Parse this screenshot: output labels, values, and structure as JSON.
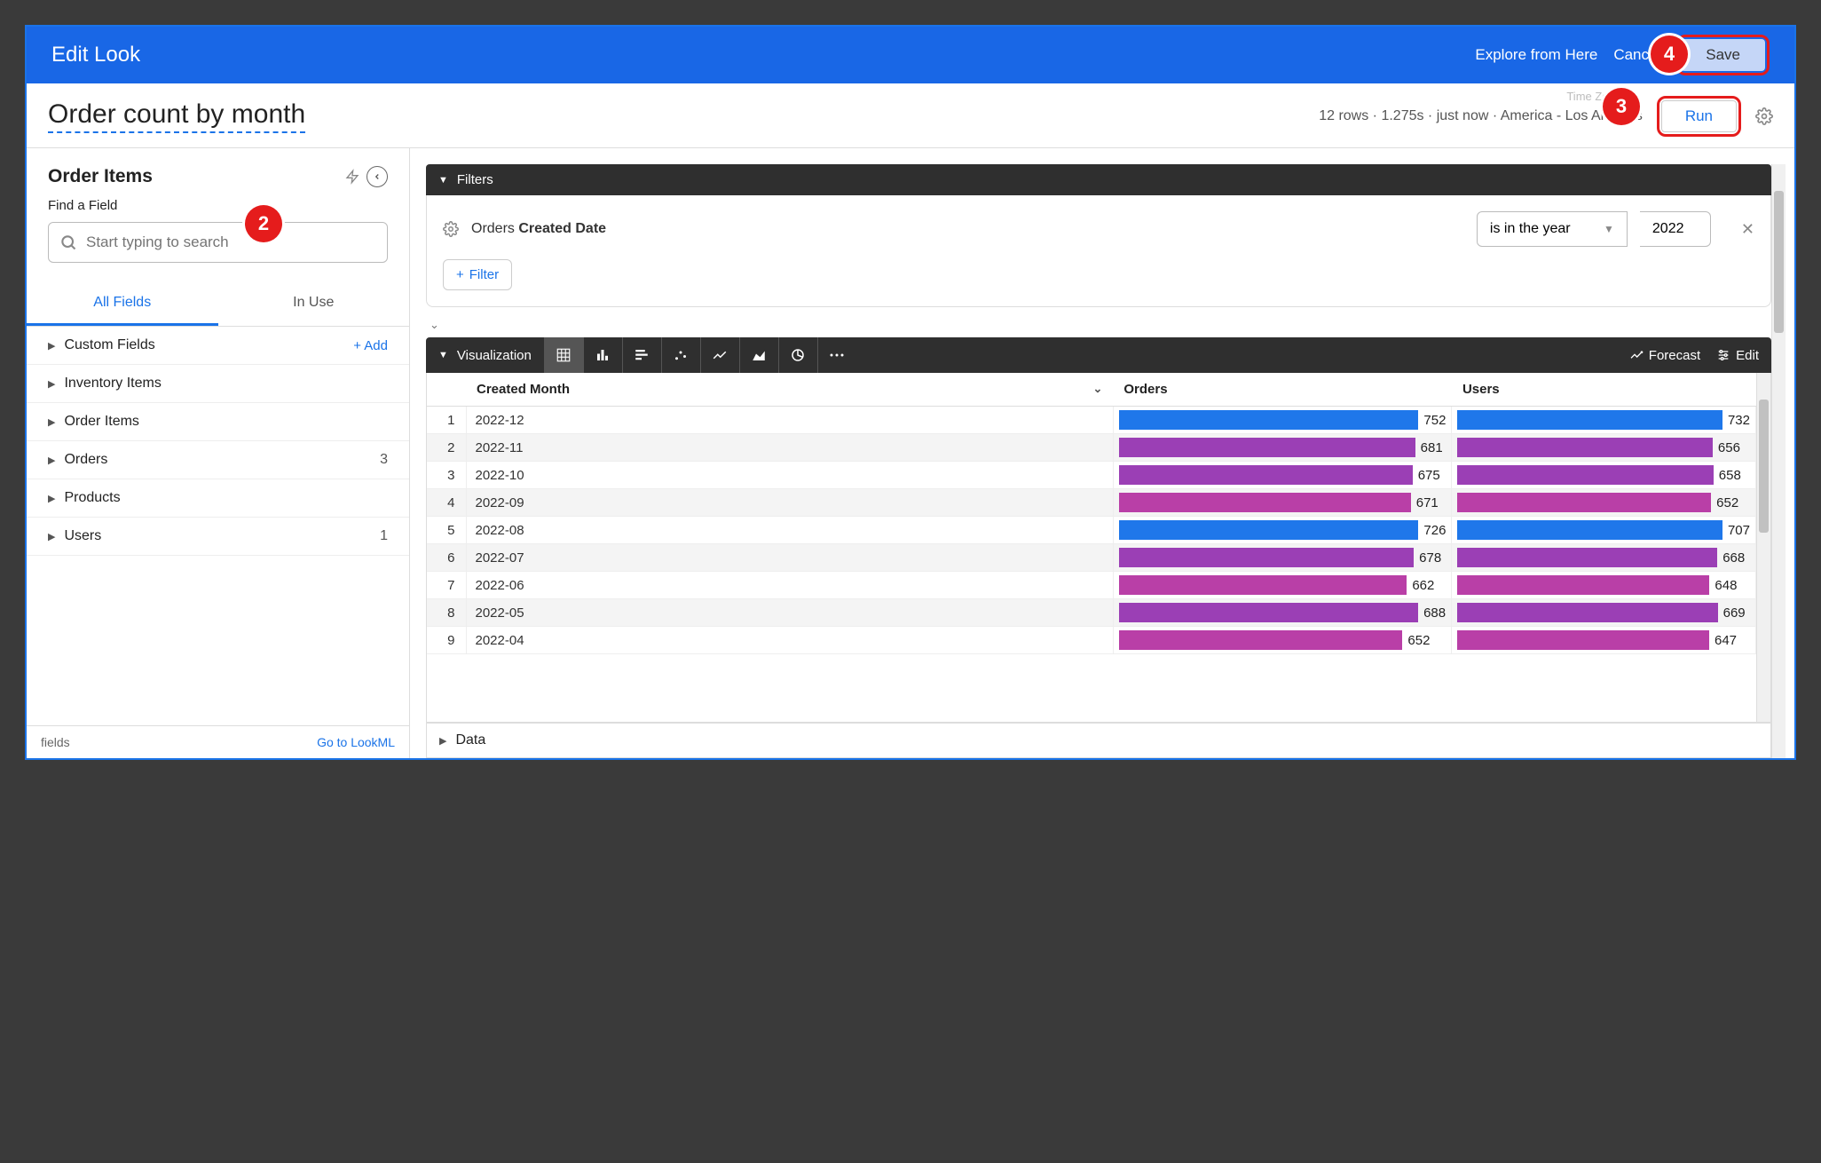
{
  "header": {
    "title": "Edit Look",
    "explore_link": "Explore from Here",
    "cancel_link": "Cancel",
    "save_label": "Save"
  },
  "title_row": {
    "look_title": "Order count by month",
    "timezone_hint": "Time Zone",
    "meta": "12 rows · 1.275s · just now · America - Los Angeles",
    "run_label": "Run"
  },
  "sidebar": {
    "heading": "Order Items",
    "find_label": "Find a Field",
    "search_placeholder": "Start typing to search",
    "tabs": {
      "all": "All Fields",
      "in_use": "In Use"
    },
    "add_label": "+  Add",
    "items": [
      {
        "label": "Custom Fields",
        "add": true
      },
      {
        "label": "Inventory Items"
      },
      {
        "label": "Order Items"
      },
      {
        "label": "Orders",
        "count": "3"
      },
      {
        "label": "Products"
      },
      {
        "label": "Users",
        "count": "1"
      }
    ],
    "footer_left": "fields",
    "footer_right": "Go to LookML"
  },
  "filters": {
    "section_label": "Filters",
    "field_prefix": "Orders ",
    "field_bold": "Created Date",
    "op_label": "is in the year",
    "value": "2022",
    "add_filter": "Filter"
  },
  "viz": {
    "section_label": "Visualization",
    "forecast": "Forecast",
    "edit": "Edit",
    "columns": {
      "month": "Created Month",
      "orders": "Orders",
      "users": "Users"
    }
  },
  "data_section": "Data",
  "annotations": {
    "two": "2",
    "three": "3",
    "four": "4"
  },
  "chart_data": {
    "type": "table",
    "title": "Order count by month",
    "columns": [
      "Created Month",
      "Orders",
      "Users"
    ],
    "rows": [
      {
        "n": 1,
        "month": "2022-12",
        "orders": 752,
        "users": 732,
        "color": "blue"
      },
      {
        "n": 2,
        "month": "2022-11",
        "orders": 681,
        "users": 656,
        "color": "purple"
      },
      {
        "n": 3,
        "month": "2022-10",
        "orders": 675,
        "users": 658,
        "color": "purple"
      },
      {
        "n": 4,
        "month": "2022-09",
        "orders": 671,
        "users": 652,
        "color": "magenta"
      },
      {
        "n": 5,
        "month": "2022-08",
        "orders": 726,
        "users": 707,
        "color": "blue"
      },
      {
        "n": 6,
        "month": "2022-07",
        "orders": 678,
        "users": 668,
        "color": "purple"
      },
      {
        "n": 7,
        "month": "2022-06",
        "orders": 662,
        "users": 648,
        "color": "magenta"
      },
      {
        "n": 8,
        "month": "2022-05",
        "orders": 688,
        "users": 669,
        "color": "purple"
      },
      {
        "n": 9,
        "month": "2022-04",
        "orders": 652,
        "users": 647,
        "color": "magenta"
      }
    ],
    "max": 752
  }
}
